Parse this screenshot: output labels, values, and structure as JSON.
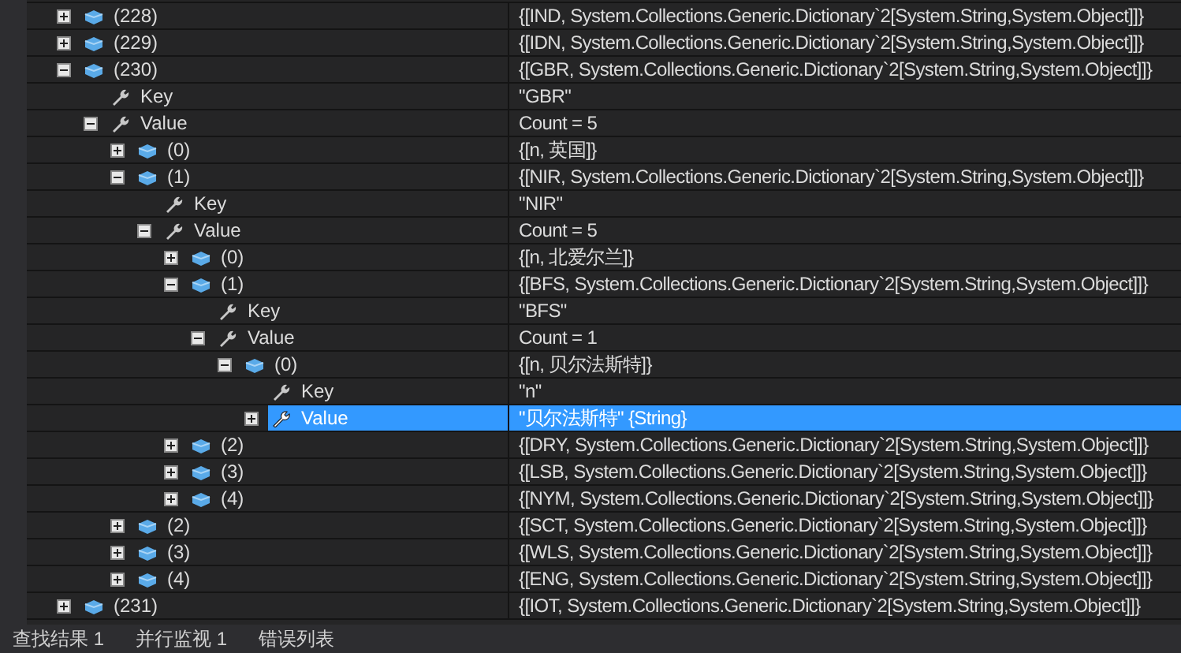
{
  "tree": [
    {
      "name": "(228)",
      "value": "{[IND, System.Collections.Generic.Dictionary`2[System.String,System.Object]]}",
      "kind": "item",
      "expanded": false,
      "selected": false
    },
    {
      "name": "(229)",
      "value": "{[IDN, System.Collections.Generic.Dictionary`2[System.String,System.Object]]}",
      "kind": "item",
      "expanded": false,
      "selected": false
    },
    {
      "name": "(230)",
      "value": "{[GBR, System.Collections.Generic.Dictionary`2[System.String,System.Object]]}",
      "kind": "item",
      "expanded": true,
      "selected": false,
      "children": [
        {
          "name": "Key",
          "value": "\"GBR\"",
          "kind": "property",
          "selected": false
        },
        {
          "name": "Value",
          "value": "Count = 5",
          "kind": "property",
          "expanded": true,
          "selected": false,
          "children": [
            {
              "name": "(0)",
              "value": "{[n, 英国]}",
              "kind": "item",
              "expanded": false,
              "selected": false
            },
            {
              "name": "(1)",
              "value": "{[NIR, System.Collections.Generic.Dictionary`2[System.String,System.Object]]}",
              "kind": "item",
              "expanded": true,
              "selected": false,
              "children": [
                {
                  "name": "Key",
                  "value": "\"NIR\"",
                  "kind": "property",
                  "selected": false
                },
                {
                  "name": "Value",
                  "value": "Count = 5",
                  "kind": "property",
                  "expanded": true,
                  "selected": false,
                  "children": [
                    {
                      "name": "(0)",
                      "value": "{[n, 北爱尔兰]}",
                      "kind": "item",
                      "expanded": false,
                      "selected": false
                    },
                    {
                      "name": "(1)",
                      "value": "{[BFS, System.Collections.Generic.Dictionary`2[System.String,System.Object]]}",
                      "kind": "item",
                      "expanded": true,
                      "selected": false,
                      "children": [
                        {
                          "name": "Key",
                          "value": "\"BFS\"",
                          "kind": "property",
                          "selected": false
                        },
                        {
                          "name": "Value",
                          "value": "Count = 1",
                          "kind": "property",
                          "expanded": true,
                          "selected": false,
                          "children": [
                            {
                              "name": "(0)",
                              "value": "{[n, 贝尔法斯特]}",
                              "kind": "item",
                              "expanded": true,
                              "selected": false,
                              "children": [
                                {
                                  "name": "Key",
                                  "value": "\"n\"",
                                  "kind": "property",
                                  "selected": false
                                },
                                {
                                  "name": "Value",
                                  "value": "\"贝尔法斯特\" {String}",
                                  "kind": "property",
                                  "expanded": false,
                                  "selected": true
                                }
                              ]
                            }
                          ]
                        }
                      ]
                    },
                    {
                      "name": "(2)",
                      "value": "{[DRY, System.Collections.Generic.Dictionary`2[System.String,System.Object]]}",
                      "kind": "item",
                      "expanded": false,
                      "selected": false
                    },
                    {
                      "name": "(3)",
                      "value": "{[LSB, System.Collections.Generic.Dictionary`2[System.String,System.Object]]}",
                      "kind": "item",
                      "expanded": false,
                      "selected": false
                    },
                    {
                      "name": "(4)",
                      "value": "{[NYM, System.Collections.Generic.Dictionary`2[System.String,System.Object]]}",
                      "kind": "item",
                      "expanded": false,
                      "selected": false
                    }
                  ]
                }
              ]
            },
            {
              "name": "(2)",
              "value": "{[SCT, System.Collections.Generic.Dictionary`2[System.String,System.Object]]}",
              "kind": "item",
              "expanded": false,
              "selected": false
            },
            {
              "name": "(3)",
              "value": "{[WLS, System.Collections.Generic.Dictionary`2[System.String,System.Object]]}",
              "kind": "item",
              "expanded": false,
              "selected": false
            },
            {
              "name": "(4)",
              "value": "{[ENG, System.Collections.Generic.Dictionary`2[System.String,System.Object]]}",
              "kind": "item",
              "expanded": false,
              "selected": false
            }
          ]
        }
      ]
    },
    {
      "name": "(231)",
      "value": "{[IOT, System.Collections.Generic.Dictionary`2[System.String,System.Object]]}",
      "kind": "item",
      "expanded": false,
      "selected": false
    }
  ],
  "bottom_tabs": [
    {
      "label": "查找结果 1",
      "selected": false
    },
    {
      "label": "并行监视 1",
      "selected": false
    },
    {
      "label": "错误列表",
      "selected": false
    }
  ]
}
